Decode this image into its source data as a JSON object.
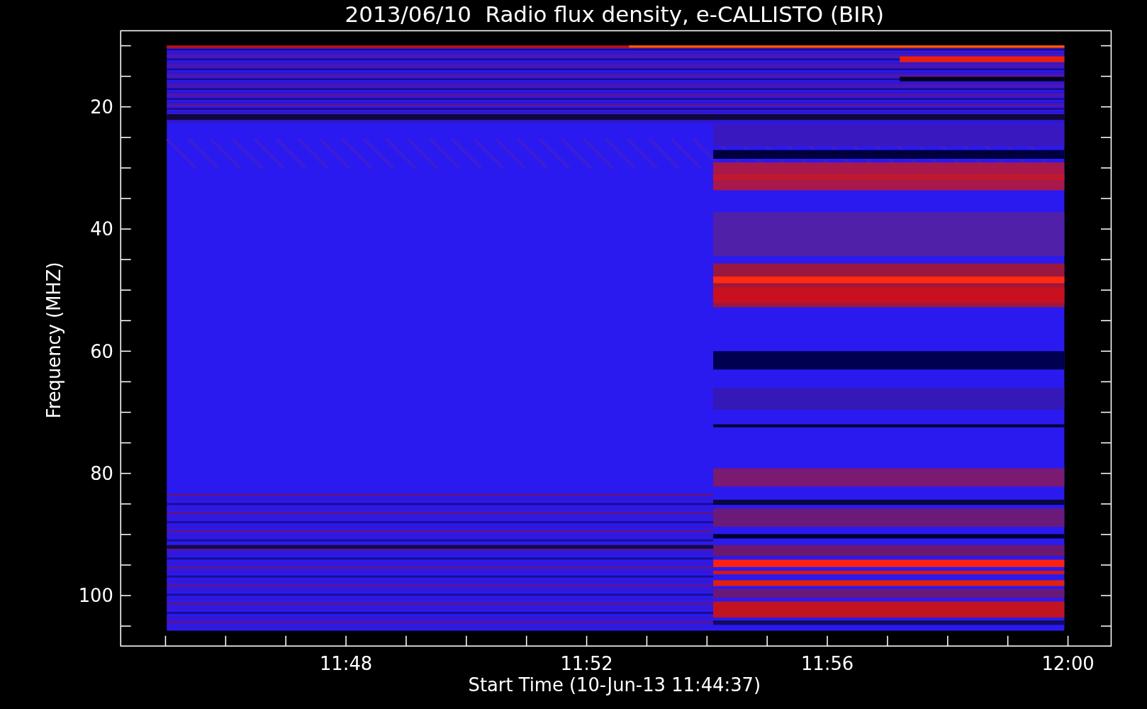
{
  "title": "2013/06/10  Radio flux density, e-CALLISTO (BIR)",
  "y_axis": {
    "label": "Frequency (MHZ)",
    "ticks": [
      "20",
      "40",
      "60",
      "80",
      "100"
    ]
  },
  "x_axis": {
    "label": "Start Time (10-Jun-13 11:44:37)",
    "ticks": [
      "11:48",
      "11:52",
      "11:56",
      "12:00"
    ]
  }
}
